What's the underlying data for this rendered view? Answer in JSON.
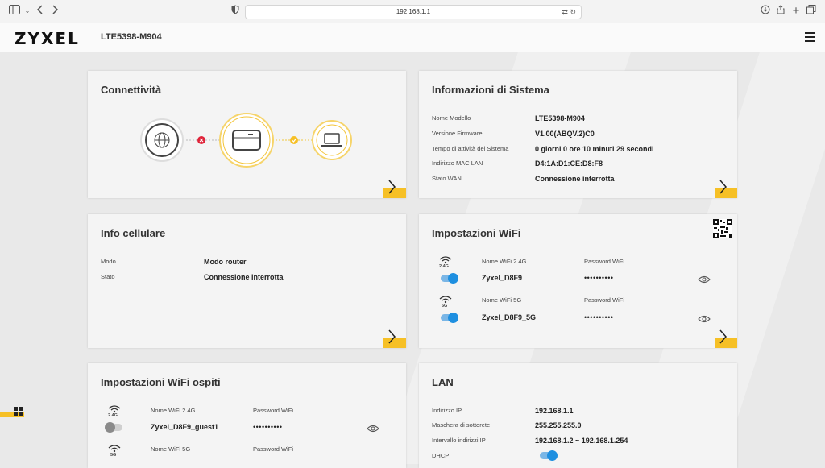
{
  "browser": {
    "url": "192.168.1.1"
  },
  "header": {
    "logo": "ZYXEL",
    "model": "LTE5398-M904"
  },
  "connectivity": {
    "title": "Connettività"
  },
  "system_info": {
    "title": "Informazioni di Sistema",
    "rows": [
      {
        "label": "Nome Modello",
        "value": "LTE5398-M904"
      },
      {
        "label": "Versione Firmware",
        "value": "V1.00(ABQV.2)C0"
      },
      {
        "label": "Tempo di attività del Sistema",
        "value": "0 giorni 0 ore 10 minuti 29 secondi"
      },
      {
        "label": "Indirizzo MAC LAN",
        "value": "D4:1A:D1:CE:D8:F8"
      },
      {
        "label": "Stato WAN",
        "value": "Connessione interrotta"
      }
    ]
  },
  "cellular": {
    "title": "Info cellulare",
    "rows": [
      {
        "label": "Modo",
        "value": "Modo router"
      },
      {
        "label": "Stato",
        "value": "Connessione interrotta"
      }
    ]
  },
  "wifi": {
    "title": "Impostazioni WiFi",
    "networks": [
      {
        "band": "2.4G",
        "name_label": "Nome WiFi 2.4G",
        "name": "Zyxel_D8F9",
        "pw_label": "Password WiFi",
        "password": "••••••••••",
        "enabled": true
      },
      {
        "band": "5G",
        "name_label": "Nome WiFi 5G",
        "name": "Zyxel_D8F9_5G",
        "pw_label": "Password WiFi",
        "password": "••••••••••",
        "enabled": true
      }
    ]
  },
  "guest_wifi": {
    "title": "Impostazioni WiFi ospiti",
    "networks": [
      {
        "band": "2.4G",
        "name_label": "Nome WiFi 2.4G",
        "name": "Zyxel_D8F9_guest1",
        "pw_label": "Password WiFi",
        "password": "••••••••••",
        "enabled": false
      },
      {
        "band": "5G",
        "name_label": "Nome WiFi 5G",
        "pw_label": "Password WiFi"
      }
    ]
  },
  "lan": {
    "title": "LAN",
    "rows": [
      {
        "label": "Indirizzo IP",
        "value": "192.168.1.1"
      },
      {
        "label": "Maschera di sottorete",
        "value": "255.255.255.0"
      },
      {
        "label": "Intervallo indirizzi IP",
        "value": "192.168.1.2 ~ 192.168.1.254"
      },
      {
        "label": "DHCP",
        "enabled": true
      }
    ]
  },
  "colors": {
    "accent": "#f6c026",
    "toggle_on": "#1e8fe0",
    "error": "#e0243a"
  },
  "icons": [
    "sidebar-toggle-icon",
    "chevron-left-icon",
    "chevron-right-icon",
    "shield-icon",
    "translate-icon",
    "reload-icon",
    "download-icon",
    "share-icon",
    "new-tab-icon",
    "tabs-icon",
    "hamburger-icon",
    "globe-icon",
    "error-x-icon",
    "router-icon",
    "check-icon",
    "laptop-icon",
    "wifi-icon",
    "eye-icon",
    "qr-code-icon",
    "grid-icon"
  ]
}
